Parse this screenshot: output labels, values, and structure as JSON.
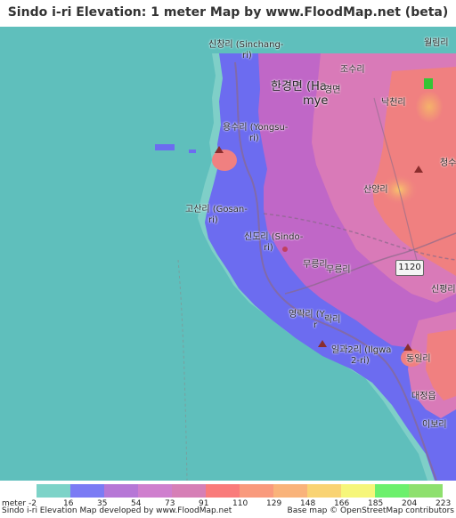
{
  "title": "Sindo i-ri Elevation: 1 meter Map by www.FloodMap.net (beta)",
  "map": {
    "colors": {
      "sea": "#5fbfbc",
      "lowland": "#6c6cf0",
      "mid": "#c067c7",
      "upper": "#d97ab8",
      "high": "#f08080",
      "peak": "#36c436"
    },
    "labels": [
      {
        "id": "sinchang",
        "text": "신창리 (Sinchang-"
      },
      {
        "id": "sinchang2",
        "text": "ri)"
      },
      {
        "id": "wollim",
        "text": "월림리"
      },
      {
        "id": "josu",
        "text": "조수리"
      },
      {
        "id": "hangyeong",
        "text": "한경면 (Ha"
      },
      {
        "id": "hangyeong2",
        "text": "mye"
      },
      {
        "id": "hangyeong3",
        "text": "경면"
      },
      {
        "id": "nakcheon",
        "text": "낙천리"
      },
      {
        "id": "yongsu",
        "text": "용수리 (Yongsu-"
      },
      {
        "id": "yongsu2",
        "text": "ri)"
      },
      {
        "id": "cheongsu",
        "text": "청수"
      },
      {
        "id": "sanyang",
        "text": "산양리"
      },
      {
        "id": "gosan",
        "text": "고산리 (Gosan-"
      },
      {
        "id": "gosan2",
        "text": "ri)"
      },
      {
        "id": "sindo",
        "text": "신도리 (Sindo-"
      },
      {
        "id": "sindo2",
        "text": "ri)"
      },
      {
        "id": "mureung1",
        "text": "무릉리"
      },
      {
        "id": "mureung2",
        "text": "무릉리"
      },
      {
        "id": "sinpyeong",
        "text": "신평리"
      },
      {
        "id": "yeongnak",
        "text": "영락리 (Y"
      },
      {
        "id": "yeongnak2",
        "text": "r"
      },
      {
        "id": "yeongnak3",
        "text": "락리"
      },
      {
        "id": "ilgwa",
        "text": "일과2리 (Ilgwa"
      },
      {
        "id": "ilgwa2",
        "text": "2-ri)"
      },
      {
        "id": "dongil",
        "text": "동일리"
      },
      {
        "id": "daejeong",
        "text": "대정읍"
      },
      {
        "id": "iseori",
        "text": "이보리"
      }
    ],
    "road_shield": "1120"
  },
  "legend": {
    "unit": "meter",
    "ticks": [
      "-2",
      "16",
      "35",
      "54",
      "73",
      "91",
      "110",
      "129",
      "148",
      "166",
      "185",
      "204",
      "223"
    ],
    "colors": [
      "#7dd3c8",
      "#7b7bf4",
      "#b677d6",
      "#cf7fce",
      "#d67fb6",
      "#f97b7b",
      "#f99a7d",
      "#f9b37a",
      "#f9d373",
      "#f6f67a",
      "#6cf06c",
      "#8ee06e"
    ]
  },
  "footer": {
    "left": "Sindo i-ri Elevation Map developed by www.FloodMap.net",
    "right": "Base map © OpenStreetMap contributors"
  }
}
